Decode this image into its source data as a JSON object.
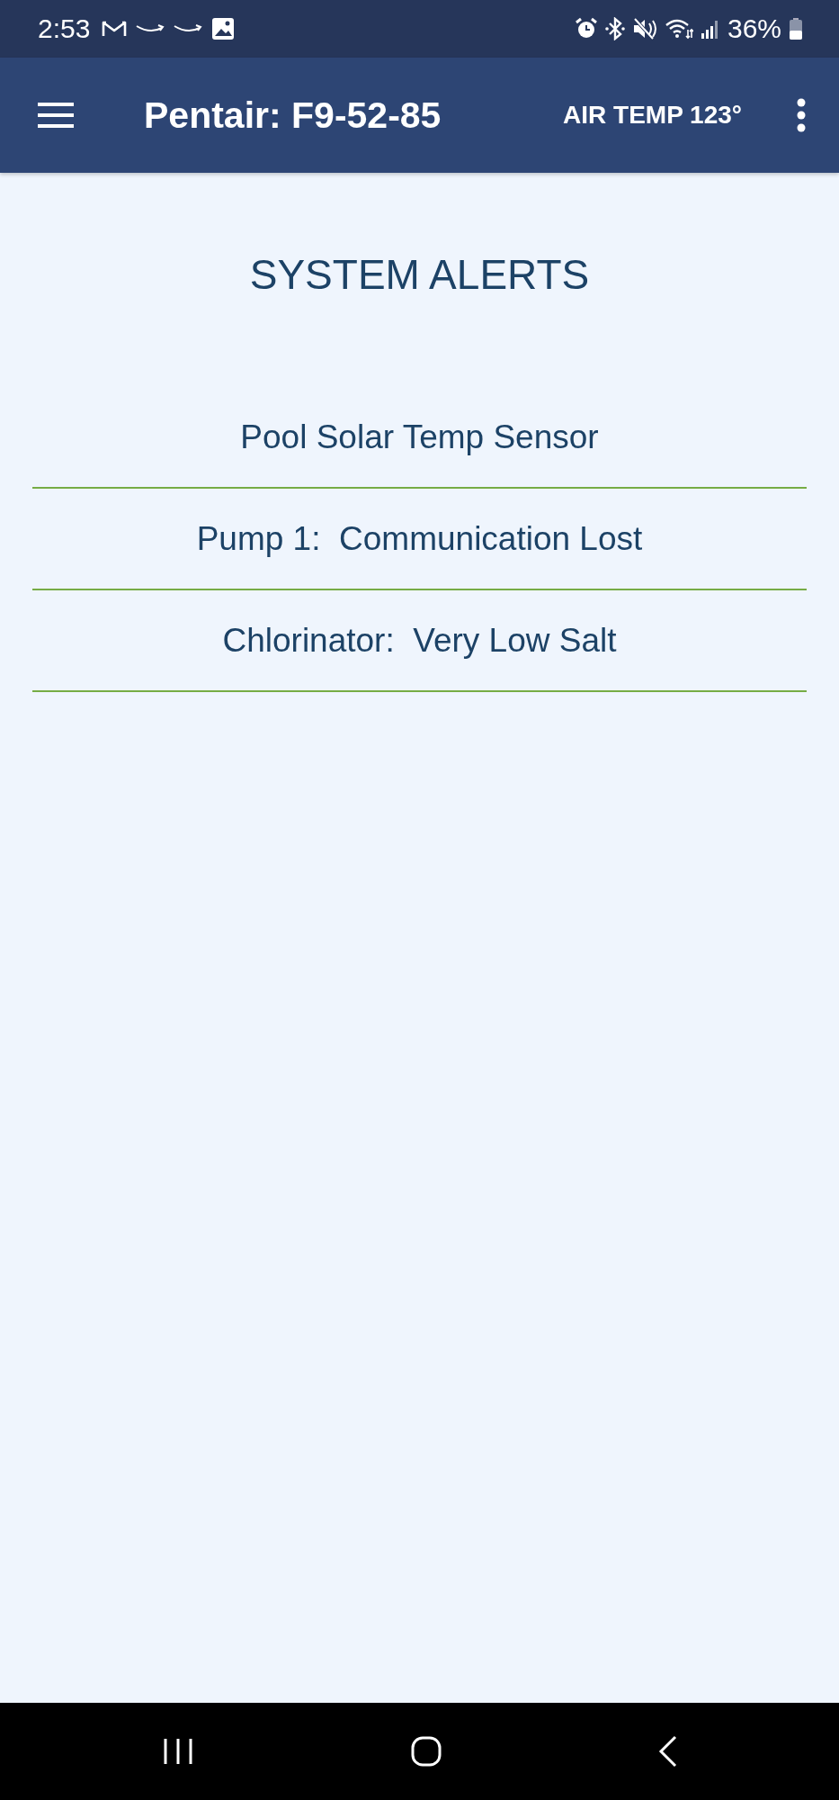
{
  "status_bar": {
    "time": "2:53",
    "battery": "36%"
  },
  "app_bar": {
    "title": "Pentair: F9-52-85",
    "air_temp": "AIR TEMP 123°"
  },
  "page_title": "SYSTEM ALERTS",
  "alerts": [
    "Pool Solar Temp Sensor",
    "Pump 1:  Communication Lost",
    "Chlorinator:  Very Low Salt"
  ]
}
